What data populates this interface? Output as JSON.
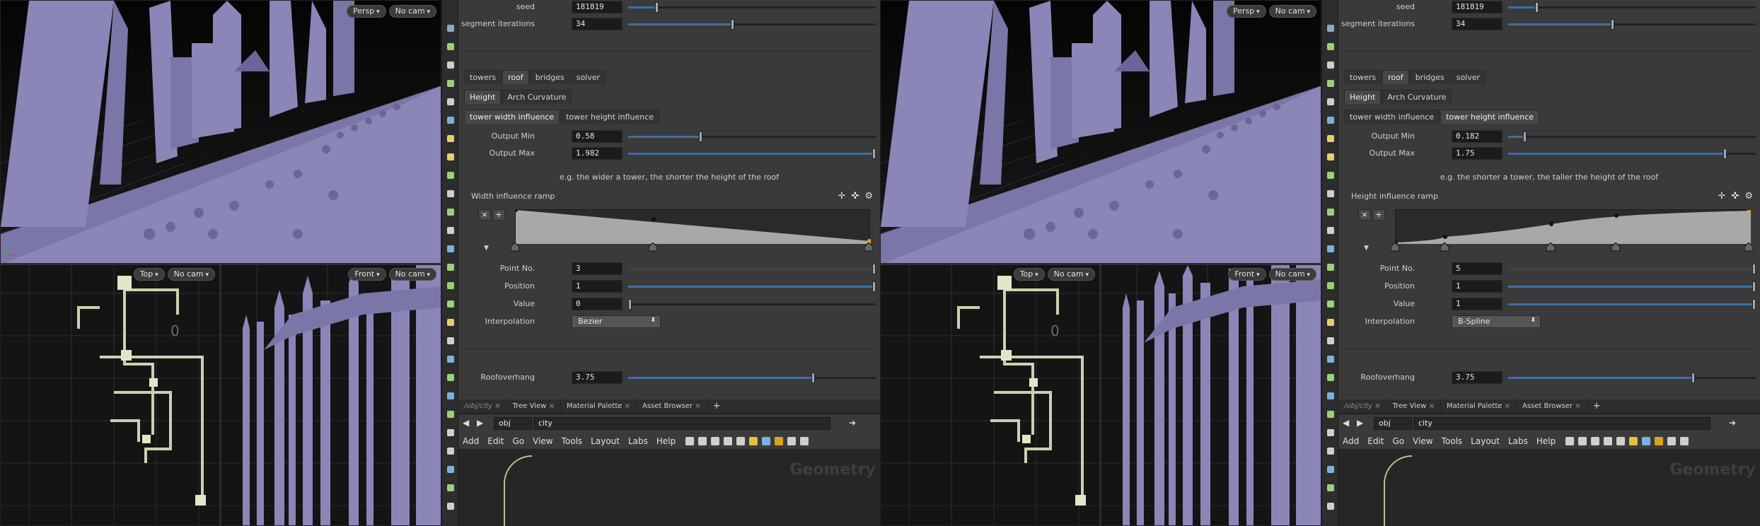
{
  "viewports": {
    "persp_label": "Persp",
    "cam_label": "No cam",
    "top_label": "Top",
    "front_label": "Front",
    "top_axis_zero": "0"
  },
  "left": {
    "params": {
      "seed_label": "seed",
      "seed_value": "181819",
      "seed_slider": 0.11,
      "seg_label": "segment iterations",
      "seg_value": "34",
      "seg_slider": 0.42,
      "main_tabs": [
        "towers",
        "roof",
        "bridges",
        "solver"
      ],
      "main_active": 1,
      "sub_tabs": [
        "Height",
        "Arch Curvature"
      ],
      "sub_active": 0,
      "infl_tabs": [
        "tower width influence",
        "tower height influence"
      ],
      "infl_active": 0,
      "out_min_label": "Output Min",
      "out_min_value": "0.58",
      "out_min_slider": 0.29,
      "out_max_label": "Output Max",
      "out_max_value": "1.982",
      "out_max_slider": 1.0,
      "hint": "e.g. the wider a tower, the shorter the height of the roof",
      "ramp_label": "Width influence ramp",
      "point_no_label": "Point No.",
      "point_no_value": "3",
      "point_no_slider": 1.0,
      "position_label": "Position",
      "position_value": "1",
      "position_slider": 1.0,
      "value_label": "Value",
      "value_value": "0",
      "value_slider": 0.0,
      "interp_label": "Interpolation",
      "interp_value": "Bezier",
      "roof_label": "Roofoverhang",
      "roof_value": "3.75",
      "roof_slider": 0.75
    },
    "net": {
      "tabs": [
        "/obj/city",
        "Tree View",
        "Material Palette",
        "Asset Browser"
      ],
      "crumb_obj": "obj",
      "crumb_city": "city",
      "menu": [
        "Add",
        "Edit",
        "Go",
        "View",
        "Tools",
        "Layout",
        "Labs",
        "Help"
      ],
      "watermark": "Geometry"
    }
  },
  "right": {
    "params": {
      "seed_label": "seed",
      "seed_value": "181819",
      "seed_slider": 0.11,
      "seg_label": "segment iterations",
      "seg_value": "34",
      "seg_slider": 0.42,
      "main_tabs": [
        "towers",
        "roof",
        "bridges",
        "solver"
      ],
      "main_active": 1,
      "sub_tabs": [
        "Height",
        "Arch Curvature"
      ],
      "sub_active": 0,
      "infl_tabs": [
        "tower width influence",
        "tower height influence"
      ],
      "infl_active": 1,
      "out_min_label": "Output Min",
      "out_min_value": "0.182",
      "out_min_slider": 0.06,
      "out_max_label": "Output Max",
      "out_max_value": "1.75",
      "out_max_slider": 0.88,
      "hint": "e.g. the shorter a tower, the taller the height of the roof",
      "ramp_label": "Height influence ramp",
      "point_no_label": "Point No.",
      "point_no_value": "5",
      "point_no_slider": 1.0,
      "position_label": "Position",
      "position_value": "1",
      "position_slider": 1.0,
      "value_label": "Value",
      "value_value": "1",
      "value_slider": 1.0,
      "interp_label": "Interpolation",
      "interp_value": "B-Spline",
      "roof_label": "Roofoverhang",
      "roof_value": "3.75",
      "roof_slider": 0.75
    },
    "net": {
      "tabs": [
        "/obj/city",
        "Tree View",
        "Material Palette",
        "Asset Browser"
      ],
      "crumb_obj": "obj",
      "crumb_city": "city",
      "menu": [
        "Add",
        "Edit",
        "Go",
        "View",
        "Tools",
        "Layout",
        "Labs",
        "Help"
      ],
      "watermark": "Geometry"
    }
  },
  "colors": {
    "model": "#8a86b8",
    "model_dark": "#6a6698",
    "grid": "#3a3a4a",
    "slider_fill": "#3d6fa8",
    "node_wire": "#c8b88a"
  },
  "icons": [
    "select-icon",
    "transform-icon",
    "lock-icon",
    "snap-icon",
    "light-icon",
    "camera-icon",
    "handle-icon",
    "view-icon"
  ]
}
